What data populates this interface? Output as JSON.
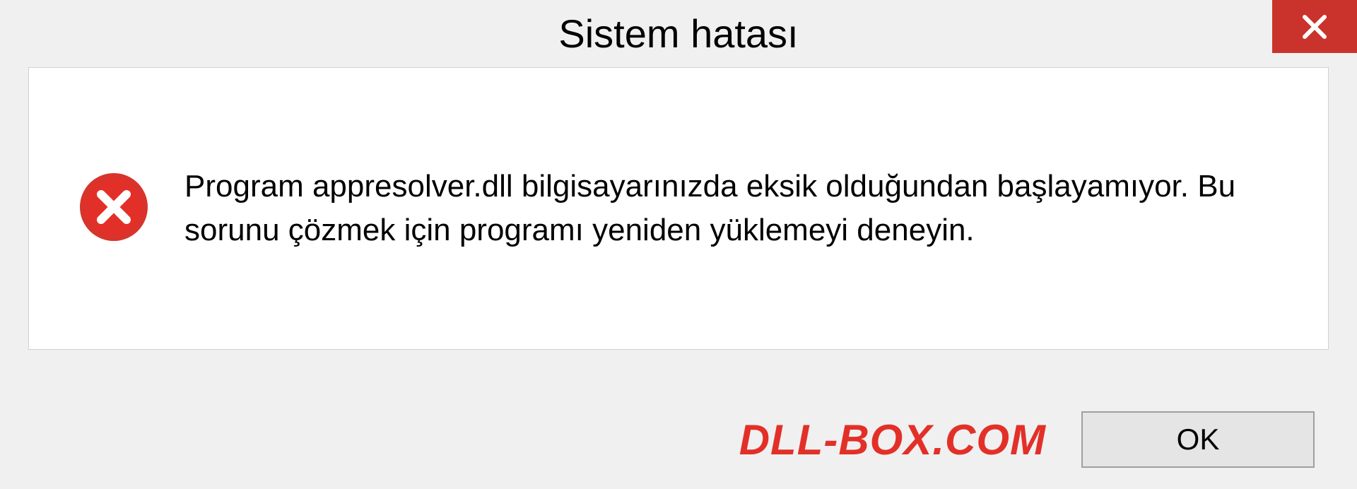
{
  "dialog": {
    "title": "Sistem hatası",
    "message": "Program appresolver.dll bilgisayarınızda eksik olduğundan başlayamıyor. Bu sorunu çözmek için programı yeniden yüklemeyi deneyin.",
    "ok_label": "OK"
  },
  "watermark": "DLL-BOX.COM"
}
